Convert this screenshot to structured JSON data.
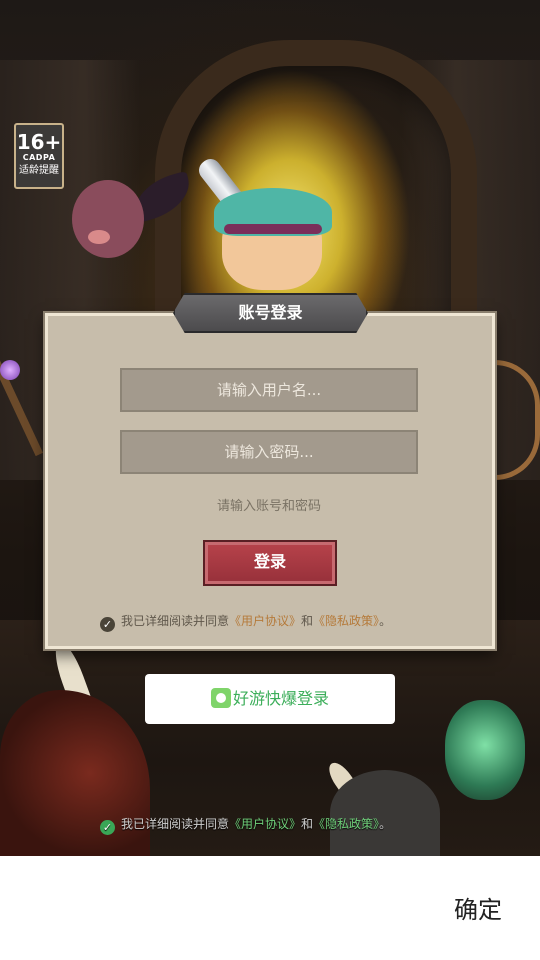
{
  "age_badge": {
    "rating": "16+",
    "org": "CADPA",
    "tip": "适龄提醒"
  },
  "login_panel": {
    "title": "账号登录",
    "username_placeholder": "请输入用户名...",
    "password_placeholder": "请输入密码...",
    "hint": "请输入账号和密码",
    "login_button": "登录",
    "agreement": {
      "prefix": "我已详细阅读并同意",
      "user_agreement": "《用户协议》",
      "and": "和",
      "privacy_policy": "《隐私政策》",
      "suffix": "。"
    }
  },
  "third_party_login": {
    "label": "好游快爆登录",
    "agreement": {
      "prefix": "我已详细阅读并同意",
      "user_agreement": "《用户协议》",
      "and": "和",
      "privacy_policy": "《隐私政策》",
      "suffix": "。"
    }
  },
  "bottom_bar": {
    "confirm": "确定"
  },
  "icons": {
    "check": "check-circle-icon",
    "haoyou_logo": "haoyou-kuaibao-logo-icon"
  },
  "colors": {
    "panel_bg": "#c7bdab",
    "login_button": "#a33a43",
    "agree_link_panel": "#b57a3a",
    "agree_link_green": "#6fcf7a",
    "haoyou_green": "#3cae5a"
  }
}
